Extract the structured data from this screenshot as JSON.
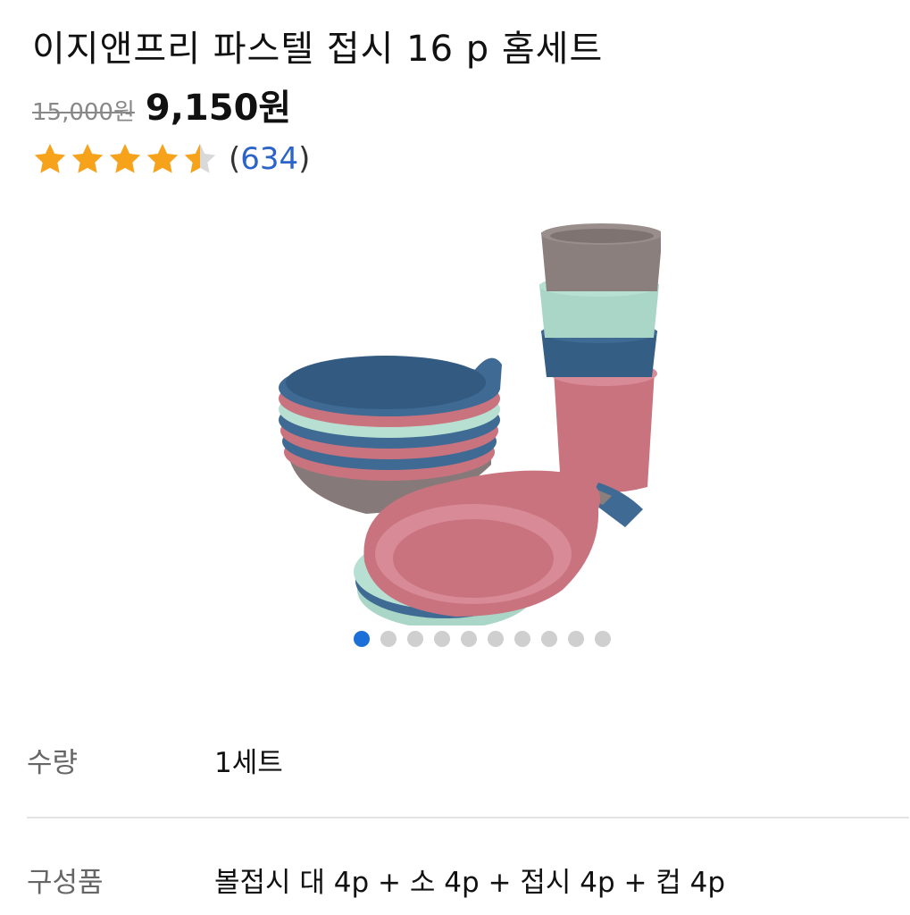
{
  "product": {
    "title": "이지앤프리 파스텔 접시 16 p 홈세트",
    "original_price": "15,000원",
    "sale_price": "9,150원",
    "rating": 4.5,
    "rating_max": 5,
    "review_open": "(",
    "review_count": "634",
    "review_close": ")"
  },
  "gallery": {
    "image_icon": "pastel-dish-set-photo",
    "dot_count": 10,
    "active_index": 0,
    "colors": {
      "active_dot": "#1a6fd8",
      "inactive_dot": "#cfcfcf",
      "star": "#f7a21b",
      "star_empty": "#d9d9d9"
    }
  },
  "details": [
    {
      "label": "수량",
      "value": "1세트"
    },
    {
      "label": "구성품",
      "value": "볼접시 대 4p + 소 4p + 접시 4p + 컵 4p"
    }
  ]
}
